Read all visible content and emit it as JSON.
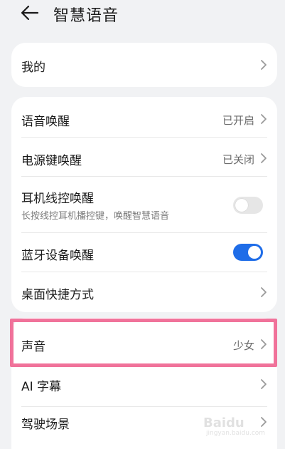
{
  "header": {
    "title": "智慧语音"
  },
  "card1": {
    "items": [
      {
        "label": "我的"
      }
    ]
  },
  "card2": {
    "items": [
      {
        "label": "语音唤醒",
        "value": "已开启"
      },
      {
        "label": "电源键唤醒",
        "value": "已关闭"
      },
      {
        "label": "耳机线控唤醒",
        "sub": "长按线控耳机播控键，唤醒智慧语音",
        "toggle": "off"
      },
      {
        "label": "蓝牙设备唤醒",
        "toggle": "on"
      },
      {
        "label": "桌面快捷方式"
      }
    ]
  },
  "card3": {
    "items": [
      {
        "label": "声音",
        "value": "少女"
      },
      {
        "label": "AI 字幕"
      },
      {
        "label": "驾驶场景"
      }
    ]
  },
  "watermark": {
    "brand": "Baidu",
    "sub": "jingyan.baidu.com"
  },
  "colors": {
    "accent": "#1f6de8",
    "highlight_border": "#f0729a",
    "background": "#f1f2f4"
  }
}
